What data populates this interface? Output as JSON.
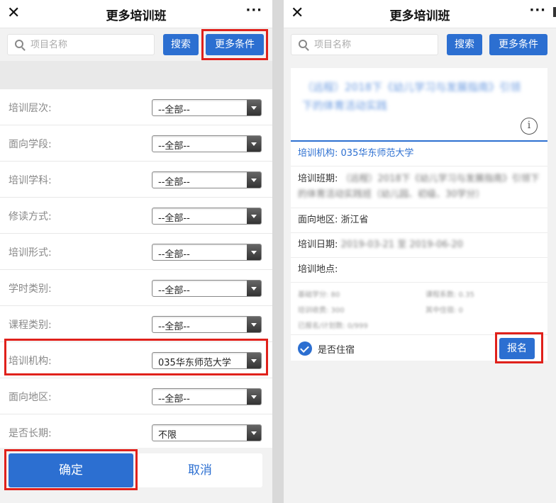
{
  "left": {
    "nav": {
      "close": "✕",
      "title": "更多培训班",
      "more": "···"
    },
    "search": {
      "placeholder": "项目名称",
      "search_label": "搜索",
      "more_label": "更多条件"
    },
    "filters": [
      {
        "label": "培训层次:",
        "value": "--全部--"
      },
      {
        "label": "面向学段:",
        "value": "--全部--"
      },
      {
        "label": "培训学科:",
        "value": "--全部--"
      },
      {
        "label": "修读方式:",
        "value": "--全部--"
      },
      {
        "label": "培训形式:",
        "value": "--全部--"
      },
      {
        "label": "学时类别:",
        "value": "--全部--"
      },
      {
        "label": "课程类别:",
        "value": "--全部--"
      },
      {
        "label": "培训机构:",
        "value": "035华东师范大学"
      },
      {
        "label": "面向地区:",
        "value": "--全部--"
      },
      {
        "label": "是否长期:",
        "value": "不限"
      }
    ],
    "confirm_label": "确定",
    "cancel_label": "取消"
  },
  "right": {
    "nav": {
      "close": "✕",
      "title": "更多培训班",
      "more": "···"
    },
    "search": {
      "placeholder": "项目名称",
      "search_label": "搜索",
      "more_label": "更多条件"
    },
    "card": {
      "title": "（远程）2018下《幼儿学习与发展指南》引领下的体育活动实践",
      "info": "i",
      "org_label": "培训机构:",
      "org_value": "035华东师范大学",
      "class_label": "培训班期:",
      "class_value": "（远程）2018下《幼儿学习与发展指南》引领下的体育活动实践班（幼儿园、初级、30学分）",
      "region_label": "面向地区:",
      "region_value": "浙江省",
      "date_label": "培训日期:",
      "date_value": "2019-03-21 至 2019-06-20",
      "place_label": "培训地点:",
      "place_value": "",
      "mini": {
        "credit": "基础学分: 80",
        "course_coef": "课程系数: 0.35",
        "fee": "培训收费: 300",
        "other": "其中住宿: 0",
        "enrolled": "已报名/计划数: 0/999"
      },
      "stay_label": "是否住宿",
      "signup_label": "报名"
    }
  },
  "colors": {
    "accent": "#2c6fd1",
    "highlight": "#e0211b"
  }
}
